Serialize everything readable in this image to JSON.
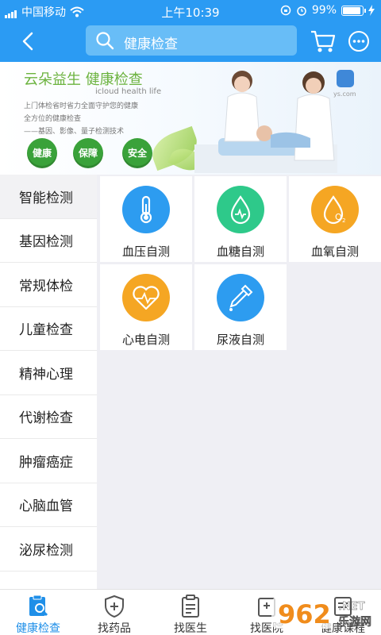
{
  "status_bar": {
    "carrier": "中国移动",
    "time": "上午10:39",
    "battery": "99%"
  },
  "nav": {
    "search_text": "健康检查"
  },
  "banner": {
    "title": "云朵益生  健康检查",
    "subtitle": "icloud health life",
    "lines": [
      "上门体检省时省力全面守护您的健康",
      "全方位的健康检查",
      "——基因、影像、量子检测技术"
    ],
    "pills": [
      "健康",
      "保障",
      "安全"
    ],
    "site_fragment": "ys.com"
  },
  "sidebar": {
    "items": [
      {
        "label": "智能检测"
      },
      {
        "label": "基因检测"
      },
      {
        "label": "常规体检"
      },
      {
        "label": "儿童检查"
      },
      {
        "label": "精神心理"
      },
      {
        "label": "代谢检查"
      },
      {
        "label": "肿瘤癌症"
      },
      {
        "label": "心脑血管"
      },
      {
        "label": "泌尿检测"
      }
    ]
  },
  "grid": {
    "items": [
      {
        "label": "血压自测",
        "icon": "thermometer-icon",
        "color": "#2d9cf0"
      },
      {
        "label": "血糖自测",
        "icon": "blood-drop-icon",
        "color": "#2ec98a"
      },
      {
        "label": "血氧自测",
        "icon": "oxygen-drop-icon",
        "color": "#f5a623"
      },
      {
        "label": "心电自测",
        "icon": "heartbeat-icon",
        "color": "#f5a623"
      },
      {
        "label": "尿液自测",
        "icon": "dropper-icon",
        "color": "#2d9cf0"
      }
    ]
  },
  "tabs": {
    "items": [
      {
        "label": "健康检查",
        "active": true
      },
      {
        "label": "找药品"
      },
      {
        "label": "找医生"
      },
      {
        "label": "找医院"
      },
      {
        "label": "健康课程"
      }
    ]
  },
  "watermark": {
    "text": "962",
    "sub": "乐游网"
  },
  "colors": {
    "primary": "#2b9bf3",
    "active_tab": "#1f8fe8"
  }
}
